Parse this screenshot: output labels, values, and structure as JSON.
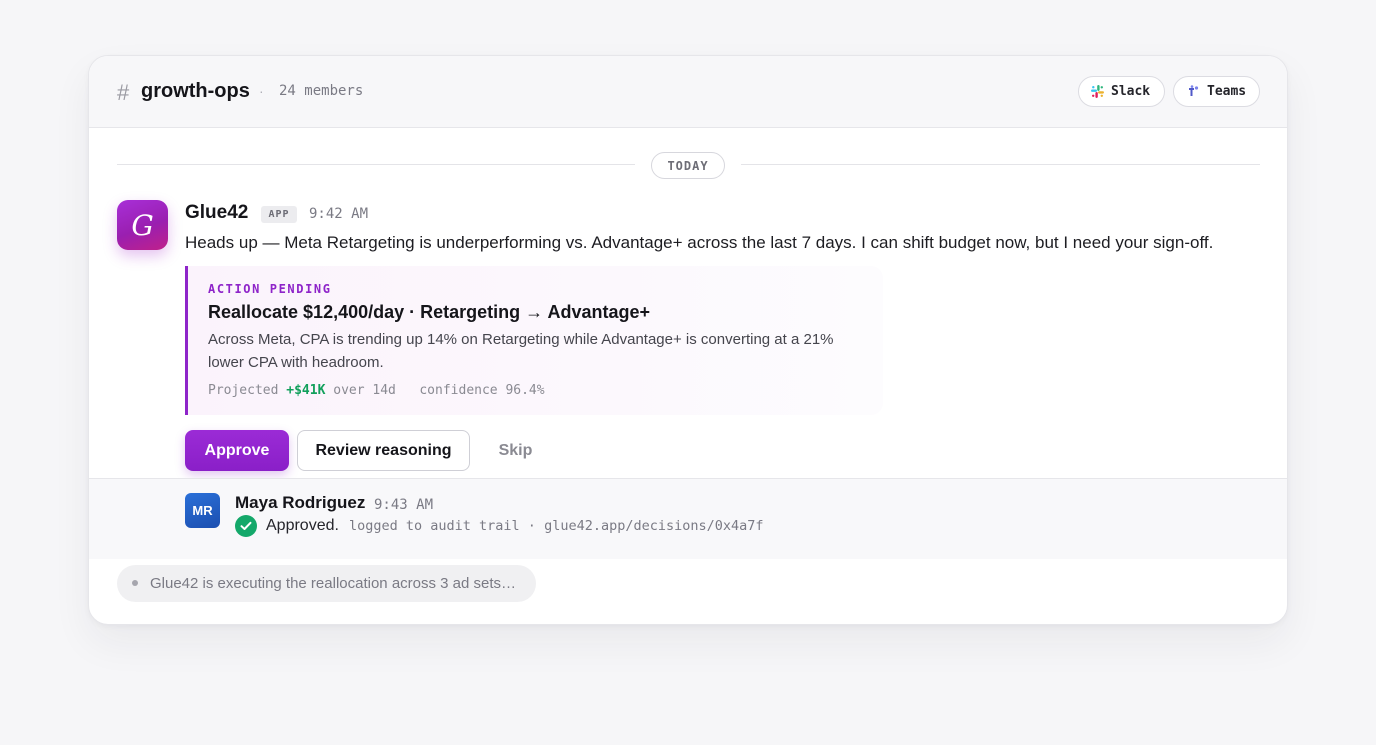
{
  "channel": {
    "hash": "#",
    "name": "growth-ops",
    "separator": "·",
    "members": "24 members"
  },
  "integrations": [
    {
      "label": "Slack",
      "icon": "slack-icon"
    },
    {
      "label": "Teams",
      "icon": "teams-icon"
    }
  ],
  "day_divider": "TODAY",
  "message": {
    "avatar_letter": "G",
    "sender": "Glue42",
    "badge": "APP",
    "time": "9:42 AM",
    "text": "Heads up — Meta Retargeting is underperforming vs. Advantage+ across the last 7 days. I can shift budget now, but I need your sign-off."
  },
  "action": {
    "status": "ACTION PENDING",
    "title": "Reallocate $12,400/day · Retargeting → Advantage+",
    "description": "Across Meta, CPA is trending up 14% on Retargeting while Advantage+ is converting at a 21% lower CPA with headroom.",
    "projected_label": "Projected",
    "projected_value": "+$41K",
    "projected_period": "over 14d",
    "confidence": "confidence 96.4%"
  },
  "buttons": {
    "approve": "Approve",
    "review": "Review reasoning",
    "skip": "Skip"
  },
  "reply": {
    "initials": "MR",
    "name": "Maya Rodriguez",
    "time": "9:43 AM",
    "approved": "Approved.",
    "audit": "logged to audit trail · glue42.app/decisions/0x4a7f"
  },
  "status_line": "Glue42 is executing the reallocation across 3 ad sets…",
  "colors": {
    "accent": "#8e24c9",
    "gain": "#12a05c",
    "approved_check": "#14a86a",
    "user_avatar": "#1c4fb0"
  }
}
